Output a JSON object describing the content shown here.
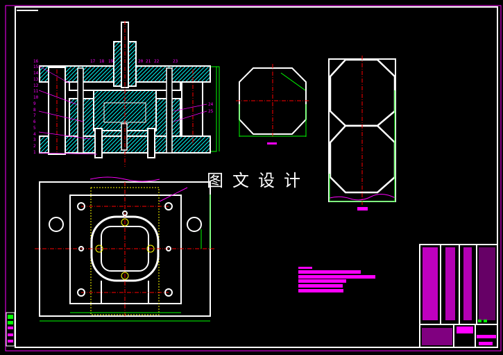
{
  "watermark": "图文设计",
  "colors": {
    "background": "#000000",
    "outline": "#ffffff",
    "hatch": "#00ffff",
    "center_line": "#ff0000",
    "dimension": "#00ff00",
    "annotation": "#ff00ff"
  },
  "section_view": {
    "left_part_numbers": [
      "16",
      "15",
      "14",
      "13",
      "12",
      "11",
      "10",
      "9",
      "8",
      "7",
      "6",
      "5",
      "4",
      "3",
      "2",
      "1"
    ],
    "top_part_numbers": [
      "17",
      "18",
      "19",
      "20",
      "21",
      "22",
      "23"
    ],
    "right_part_numbers": [
      "24",
      "25"
    ]
  }
}
